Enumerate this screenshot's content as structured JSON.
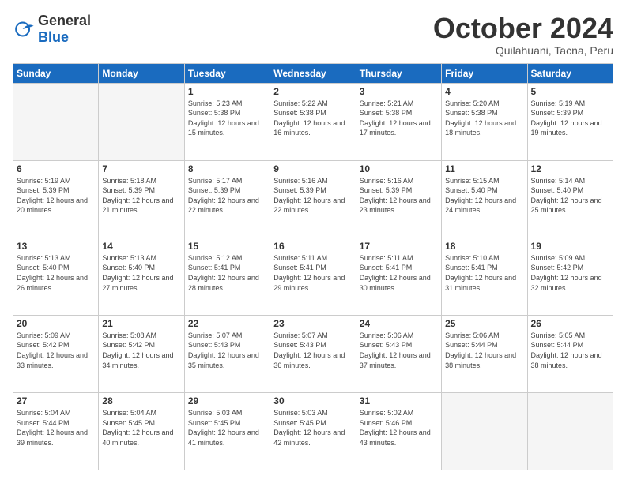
{
  "logo": {
    "general": "General",
    "blue": "Blue"
  },
  "header": {
    "month": "October 2024",
    "location": "Quilahuani, Tacna, Peru"
  },
  "weekdays": [
    "Sunday",
    "Monday",
    "Tuesday",
    "Wednesday",
    "Thursday",
    "Friday",
    "Saturday"
  ],
  "weeks": [
    [
      {
        "day": "",
        "empty": true
      },
      {
        "day": "",
        "empty": true
      },
      {
        "day": "1",
        "sunrise": "5:23 AM",
        "sunset": "5:38 PM",
        "daylight": "12 hours and 15 minutes."
      },
      {
        "day": "2",
        "sunrise": "5:22 AM",
        "sunset": "5:38 PM",
        "daylight": "12 hours and 16 minutes."
      },
      {
        "day": "3",
        "sunrise": "5:21 AM",
        "sunset": "5:38 PM",
        "daylight": "12 hours and 17 minutes."
      },
      {
        "day": "4",
        "sunrise": "5:20 AM",
        "sunset": "5:38 PM",
        "daylight": "12 hours and 18 minutes."
      },
      {
        "day": "5",
        "sunrise": "5:19 AM",
        "sunset": "5:39 PM",
        "daylight": "12 hours and 19 minutes."
      }
    ],
    [
      {
        "day": "6",
        "sunrise": "5:19 AM",
        "sunset": "5:39 PM",
        "daylight": "12 hours and 20 minutes."
      },
      {
        "day": "7",
        "sunrise": "5:18 AM",
        "sunset": "5:39 PM",
        "daylight": "12 hours and 21 minutes."
      },
      {
        "day": "8",
        "sunrise": "5:17 AM",
        "sunset": "5:39 PM",
        "daylight": "12 hours and 22 minutes."
      },
      {
        "day": "9",
        "sunrise": "5:16 AM",
        "sunset": "5:39 PM",
        "daylight": "12 hours and 22 minutes."
      },
      {
        "day": "10",
        "sunrise": "5:16 AM",
        "sunset": "5:39 PM",
        "daylight": "12 hours and 23 minutes."
      },
      {
        "day": "11",
        "sunrise": "5:15 AM",
        "sunset": "5:40 PM",
        "daylight": "12 hours and 24 minutes."
      },
      {
        "day": "12",
        "sunrise": "5:14 AM",
        "sunset": "5:40 PM",
        "daylight": "12 hours and 25 minutes."
      }
    ],
    [
      {
        "day": "13",
        "sunrise": "5:13 AM",
        "sunset": "5:40 PM",
        "daylight": "12 hours and 26 minutes."
      },
      {
        "day": "14",
        "sunrise": "5:13 AM",
        "sunset": "5:40 PM",
        "daylight": "12 hours and 27 minutes."
      },
      {
        "day": "15",
        "sunrise": "5:12 AM",
        "sunset": "5:41 PM",
        "daylight": "12 hours and 28 minutes."
      },
      {
        "day": "16",
        "sunrise": "5:11 AM",
        "sunset": "5:41 PM",
        "daylight": "12 hours and 29 minutes."
      },
      {
        "day": "17",
        "sunrise": "5:11 AM",
        "sunset": "5:41 PM",
        "daylight": "12 hours and 30 minutes."
      },
      {
        "day": "18",
        "sunrise": "5:10 AM",
        "sunset": "5:41 PM",
        "daylight": "12 hours and 31 minutes."
      },
      {
        "day": "19",
        "sunrise": "5:09 AM",
        "sunset": "5:42 PM",
        "daylight": "12 hours and 32 minutes."
      }
    ],
    [
      {
        "day": "20",
        "sunrise": "5:09 AM",
        "sunset": "5:42 PM",
        "daylight": "12 hours and 33 minutes."
      },
      {
        "day": "21",
        "sunrise": "5:08 AM",
        "sunset": "5:42 PM",
        "daylight": "12 hours and 34 minutes."
      },
      {
        "day": "22",
        "sunrise": "5:07 AM",
        "sunset": "5:43 PM",
        "daylight": "12 hours and 35 minutes."
      },
      {
        "day": "23",
        "sunrise": "5:07 AM",
        "sunset": "5:43 PM",
        "daylight": "12 hours and 36 minutes."
      },
      {
        "day": "24",
        "sunrise": "5:06 AM",
        "sunset": "5:43 PM",
        "daylight": "12 hours and 37 minutes."
      },
      {
        "day": "25",
        "sunrise": "5:06 AM",
        "sunset": "5:44 PM",
        "daylight": "12 hours and 38 minutes."
      },
      {
        "day": "26",
        "sunrise": "5:05 AM",
        "sunset": "5:44 PM",
        "daylight": "12 hours and 38 minutes."
      }
    ],
    [
      {
        "day": "27",
        "sunrise": "5:04 AM",
        "sunset": "5:44 PM",
        "daylight": "12 hours and 39 minutes."
      },
      {
        "day": "28",
        "sunrise": "5:04 AM",
        "sunset": "5:45 PM",
        "daylight": "12 hours and 40 minutes."
      },
      {
        "day": "29",
        "sunrise": "5:03 AM",
        "sunset": "5:45 PM",
        "daylight": "12 hours and 41 minutes."
      },
      {
        "day": "30",
        "sunrise": "5:03 AM",
        "sunset": "5:45 PM",
        "daylight": "12 hours and 42 minutes."
      },
      {
        "day": "31",
        "sunrise": "5:02 AM",
        "sunset": "5:46 PM",
        "daylight": "12 hours and 43 minutes."
      },
      {
        "day": "",
        "empty": true
      },
      {
        "day": "",
        "empty": true
      }
    ]
  ]
}
